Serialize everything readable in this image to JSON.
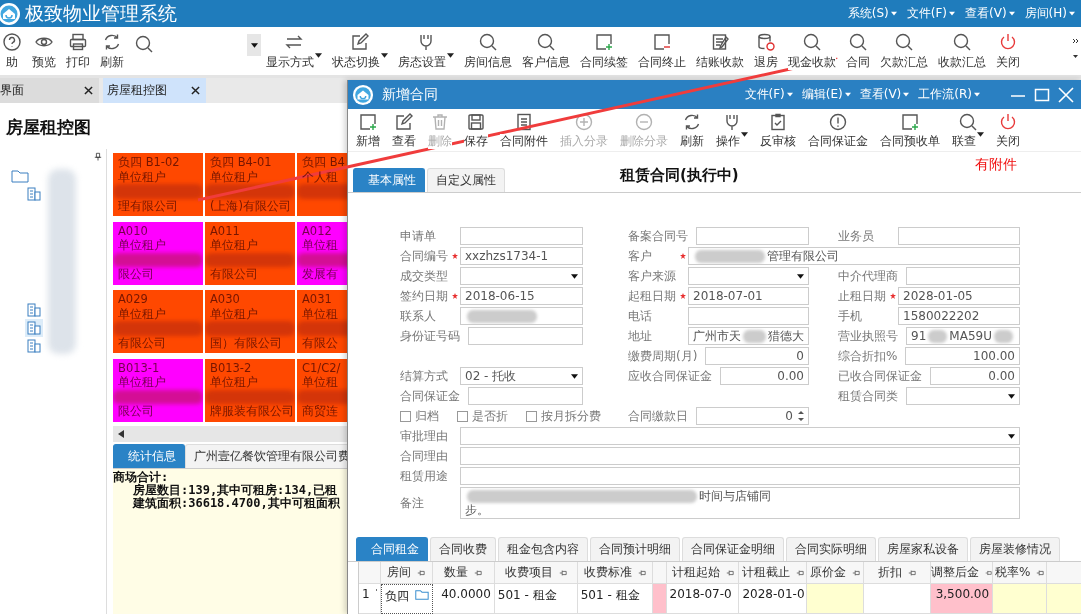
{
  "window": {
    "title": "极致物业管理系统",
    "menus": [
      "系统(S)",
      "文件(F)",
      "查看(V)",
      "房间(H)"
    ]
  },
  "toolbar": [
    {
      "kind": "button",
      "label": "助"
    },
    {
      "kind": "button",
      "label": "预览"
    },
    {
      "kind": "button",
      "label": "打印"
    },
    {
      "kind": "button",
      "label": "刷新"
    },
    {
      "kind": "icon"
    },
    {
      "kind": "caret"
    },
    {
      "kind": "dropdown",
      "label": "显示方式"
    },
    {
      "kind": "dropdown",
      "label": "状态切换"
    },
    {
      "kind": "dropdown",
      "label": "房态设置"
    },
    {
      "kind": "button",
      "label": "房间信息"
    },
    {
      "kind": "button",
      "label": "客户信息"
    },
    {
      "kind": "button",
      "label": "合同续签"
    },
    {
      "kind": "button",
      "label": "合同终止"
    },
    {
      "kind": "button",
      "label": "结账收款"
    },
    {
      "kind": "button",
      "label": "退房"
    },
    {
      "kind": "button",
      "label": "现金收款"
    },
    {
      "kind": "button",
      "label": "合同"
    },
    {
      "kind": "button",
      "label": "欠款汇总"
    },
    {
      "kind": "button",
      "label": "收款汇总"
    },
    {
      "kind": "button",
      "label": "关闭"
    }
  ],
  "tabs": [
    {
      "label": "界面",
      "selected": false
    },
    {
      "label": "房屋租控图",
      "selected": true
    }
  ],
  "page_title": "房屋租控图",
  "tree": [
    {
      "selected": false,
      "children": [
        {
          "selected": false
        },
        {
          "selected": false
        },
        {
          "selected": true
        },
        {
          "selected": false
        }
      ]
    }
  ],
  "rooms": [
    {
      "code": "负四 B1-02",
      "tenant": "单位租户",
      "tail": "理有限公司",
      "color": "#ff4800"
    },
    {
      "code": "负四 B4-01",
      "tenant": "单位租户",
      "tail": "(上海)有限公司",
      "color": "#ff4800"
    },
    {
      "code": "负四 B4",
      "tenant": "个人租",
      "color": "#ff4800"
    },
    {
      "code": "A010",
      "tenant": "单位租户",
      "tail": "限公司",
      "color": "#ff00ff"
    },
    {
      "code": "A011",
      "tenant": "单位租户",
      "tail": "有限公司",
      "color": "#ff4800"
    },
    {
      "code": "A012",
      "tenant": "单位租",
      "tail": "发展有",
      "color": "#ff00ff"
    },
    {
      "code": "A029",
      "tenant": "单位租户",
      "tail": "有限公司",
      "color": "#ff4800"
    },
    {
      "code": "A030",
      "tenant": "单位租户",
      "tail": "国）有限公司",
      "color": "#ff4800"
    },
    {
      "code": "A031",
      "tenant": "单位租",
      "tail": "有限公",
      "color": "#ff4800"
    },
    {
      "code": "B013-1",
      "tenant": "单位租户",
      "tail": "限公司",
      "color": "#ff00ff"
    },
    {
      "code": "B013-2",
      "tenant": "单位租户",
      "tail": "牌服装有限公司",
      "color": "#ff4800"
    },
    {
      "code": "C1/C2/",
      "tenant": "单位租",
      "tail": "商贸连",
      "color": "#ff4800"
    }
  ],
  "bottom_tabs": [
    {
      "label": "统计信息",
      "selected": true
    },
    {
      "label": "广州壹亿餐饮管理有限公司费",
      "selected": false
    }
  ],
  "stats": [
    "商场合计:",
    "房屋数目:139,其中可租房:134,已租",
    "建筑面积:36618.4700,其中可租面积"
  ],
  "dialog": {
    "title": "新增合同",
    "menus": [
      "文件(F)",
      "编辑(E)",
      "查看(V)",
      "工作流(R)"
    ],
    "toolbar": [
      {
        "kind": "button",
        "label": "新增",
        "disabled": false
      },
      {
        "kind": "button",
        "label": "查看",
        "disabled": false
      },
      {
        "kind": "button",
        "label": "删除",
        "disabled": true
      },
      {
        "kind": "button",
        "label": "保存",
        "disabled": false
      },
      {
        "kind": "button",
        "label": "合同附件",
        "disabled": false
      },
      {
        "kind": "button",
        "label": "插入分录",
        "disabled": true
      },
      {
        "kind": "button",
        "label": "删除分录",
        "disabled": true
      },
      {
        "kind": "button",
        "label": "刷新",
        "disabled": false
      },
      {
        "kind": "dropdown",
        "label": "操作",
        "disabled": false
      },
      {
        "kind": "button",
        "label": "反审核",
        "disabled": false
      },
      {
        "kind": "button",
        "label": "合同保证金",
        "disabled": false
      },
      {
        "kind": "button",
        "label": "合同预收单",
        "disabled": false
      },
      {
        "kind": "dropdown",
        "label": "联查",
        "disabled": false
      },
      {
        "kind": "button",
        "label": "关闭",
        "disabled": false
      }
    ],
    "tabs": [
      {
        "label": "基本属性",
        "selected": true
      },
      {
        "label": "自定义属性",
        "selected": false
      }
    ],
    "heading": "租赁合同(执行中)",
    "notice": "有附件",
    "form": [
      [
        {
          "label": "申请单",
          "kind": "text"
        },
        {
          "label": "备案合同号",
          "kind": "text"
        },
        {
          "label": "业务员",
          "kind": "text"
        }
      ],
      [
        {
          "label": "合同编号",
          "kind": "text",
          "required": true,
          "value": "xxzhzs1734-1"
        },
        {
          "label": "客户",
          "kind": "text",
          "required": true,
          "segments": [
            {
              "kind": "blur"
            },
            {
              "kind": "text",
              "text": "管理有限公司"
            }
          ]
        }
      ],
      [
        {
          "label": "成交类型",
          "kind": "select"
        },
        {
          "label": "客户来源",
          "kind": "select"
        },
        {
          "label": "中介代理商",
          "kind": "text"
        }
      ],
      [
        {
          "label": "签约日期",
          "kind": "text",
          "required": true,
          "value": "2018-06-15"
        },
        {
          "label": "起租日期",
          "kind": "text",
          "required": true,
          "value": "2018-07-01"
        },
        {
          "label": "止租日期",
          "kind": "text",
          "required": true,
          "value": "2028-01-05"
        }
      ],
      [
        {
          "label": "联系人",
          "kind": "text",
          "segments": [
            {
              "kind": "blur"
            }
          ]
        },
        {
          "label": "电话",
          "kind": "text"
        },
        {
          "label": "手机",
          "kind": "text",
          "value": "1580022202"
        }
      ],
      [
        {
          "label": "身份证号码",
          "kind": "text"
        },
        {
          "label": "地址",
          "kind": "text",
          "segments": [
            {
              "kind": "text",
              "text": "广州市天"
            },
            {
              "kind": "blur"
            },
            {
              "kind": "text",
              "text": "猎德大"
            }
          ]
        },
        {
          "label": "营业执照号",
          "kind": "text",
          "segments": [
            {
              "kind": "text",
              "text": "91"
            },
            {
              "kind": "blur"
            },
            {
              "kind": "text",
              "text": "MA59U"
            },
            {
              "kind": "blur"
            }
          ]
        }
      ],
      [
        {
          "kind": "empty"
        },
        {
          "label": "缴费周期(月)",
          "kind": "number",
          "value": "0"
        },
        {
          "label": "综合折扣%",
          "kind": "number",
          "value": "100.00"
        }
      ],
      [
        {
          "label": "结算方式",
          "kind": "select",
          "value": "02 - 托收"
        },
        {
          "label": "应收合同保证金",
          "kind": "number",
          "value": "0.00"
        },
        {
          "label": "已收合同保证金",
          "kind": "number",
          "value": "0.00"
        }
      ],
      [
        {
          "label": "合同保证金",
          "kind": "text"
        },
        {
          "kind": "empty"
        },
        {
          "label": "租赁合同类",
          "kind": "select"
        }
      ],
      [
        {
          "kind": "checks",
          "items": [
            {
              "label": "归档",
              "checked": false
            },
            {
              "label": "是否折",
              "checked": false
            },
            {
              "label": "按月拆分费",
              "checked": false
            }
          ]
        },
        {
          "label": "合同缴款日",
          "kind": "spin",
          "value": "0"
        },
        {
          "kind": "empty"
        }
      ],
      [
        {
          "label": "审批理由",
          "kind": "select"
        }
      ],
      [
        {
          "label": "合同理由",
          "kind": "text"
        }
      ],
      [
        {
          "label": "租赁用途",
          "kind": "text"
        }
      ],
      [
        {
          "label": "备注",
          "kind": "memo",
          "segments": [
            {
              "kind": "blur"
            },
            {
              "kind": "text",
              "text": "时间与店铺同"
            },
            {
              "kind": "break"
            },
            {
              "kind": "text",
              "text": "步。"
            }
          ]
        }
      ]
    ],
    "detail_tabs": [
      {
        "label": "合同租金",
        "selected": true
      },
      {
        "label": "合同收费",
        "selected": false
      },
      {
        "label": "租金包含内容",
        "selected": false
      },
      {
        "label": "合同预计明细",
        "selected": false
      },
      {
        "label": "合同保证金明细",
        "selected": false
      },
      {
        "label": "合同实际明细",
        "selected": false
      },
      {
        "label": "房屋家私设备",
        "selected": false
      },
      {
        "label": "房屋装修情况",
        "selected": false
      }
    ],
    "table": {
      "columns": [
        {
          "kind": "blank"
        },
        {
          "label": "房间"
        },
        {
          "label": "数量"
        },
        {
          "label": "收费项目"
        },
        {
          "label": "收费标准"
        },
        {
          "kind": "blank"
        },
        {
          "label": "计租起始"
        },
        {
          "label": "计租截止"
        },
        {
          "label": "原价金"
        },
        {
          "label": "折扣"
        },
        {
          "label": "调整后金"
        },
        {
          "label": "税率%"
        },
        {
          "kind": "blank"
        }
      ],
      "rows": [
        {
          "cells": [
            {
              "text": "1",
              "kind": "rownum"
            },
            {
              "text": "负四",
              "kind": "room"
            },
            {
              "text": "40.0000",
              "kind": "number"
            },
            {
              "text": "501 - 租金"
            },
            {
              "text": "501 - 租金"
            },
            {
              "color": "#ffc0cb"
            },
            {
              "text": "2018-07-0"
            },
            {
              "text": "2028-01-0"
            },
            {
              "color": "#ffffd0"
            },
            {},
            {
              "text": "3,500.00",
              "kind": "number",
              "color": "#ffc0cb"
            },
            {
              "color": "#ffffd0"
            },
            {
              "color": "#ffffd0"
            }
          ]
        }
      ]
    }
  }
}
